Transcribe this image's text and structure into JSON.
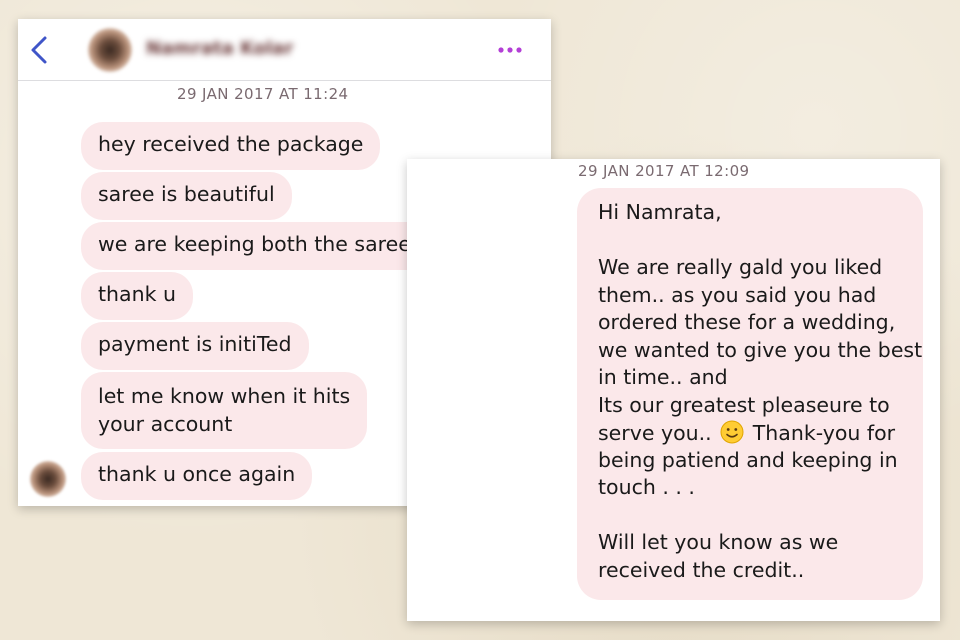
{
  "left_card": {
    "header": {
      "back_icon": "chevron-left-icon",
      "contact_name": "Namrata Kolar",
      "more_icon": "more-dots-icon"
    },
    "timestamp": "29 JAN 2017 AT 11:24",
    "messages": [
      "hey received the package",
      "saree is beautiful",
      "we are keeping both the sarees",
      "thank u",
      "payment is initiTed",
      "let me know when it hits\nyour account",
      "thank u once again"
    ]
  },
  "right_card": {
    "timestamp": "29 JAN 2017 AT 12:09",
    "reply_lines": [
      "Hi Namrata,",
      "",
      "We are really gald you liked",
      "them.. as you said you had",
      "ordered these for a wedding,",
      "we wanted to give you the best",
      "in time.. and",
      "Its our greatest pleaseure to",
      "serve you..",
      "Thank-you for",
      "being patiend and keeping in",
      "touch . . .",
      "",
      "Will let you know as we",
      "received the credit.."
    ],
    "emoji_icon": "smiley-emoji-icon"
  },
  "colors": {
    "background": "#efe7d6",
    "bubble": "#fbe8ea",
    "back_icon": "#3f55c8",
    "more_icon": "#b33fd6",
    "timestamp": "#7a6a70"
  }
}
